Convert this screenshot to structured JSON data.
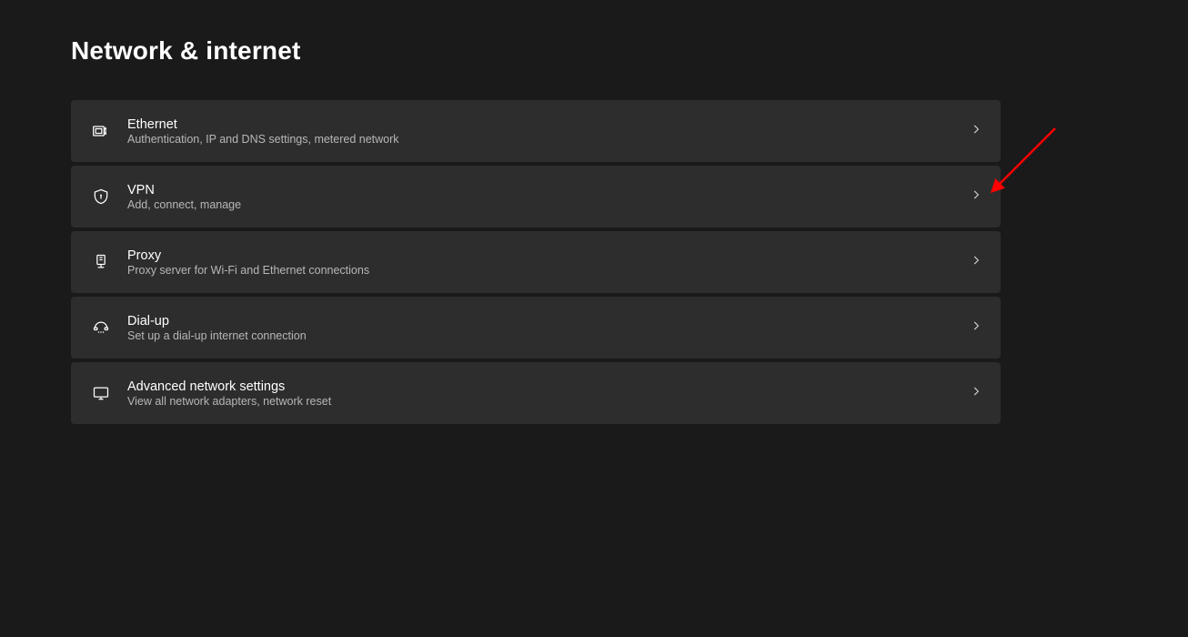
{
  "page": {
    "title": "Network & internet"
  },
  "items": [
    {
      "id": "ethernet",
      "title": "Ethernet",
      "subtitle": "Authentication, IP and DNS settings, metered network",
      "icon": "ethernet-icon"
    },
    {
      "id": "vpn",
      "title": "VPN",
      "subtitle": "Add, connect, manage",
      "icon": "shield-icon"
    },
    {
      "id": "proxy",
      "title": "Proxy",
      "subtitle": "Proxy server for Wi-Fi and Ethernet connections",
      "icon": "proxy-icon"
    },
    {
      "id": "dialup",
      "title": "Dial-up",
      "subtitle": "Set up a dial-up internet connection",
      "icon": "dialup-icon"
    },
    {
      "id": "advanced",
      "title": "Advanced network settings",
      "subtitle": "View all network adapters, network reset",
      "icon": "advanced-network-icon"
    }
  ],
  "annotation": {
    "target_item": "vpn",
    "color": "#ff0000"
  }
}
